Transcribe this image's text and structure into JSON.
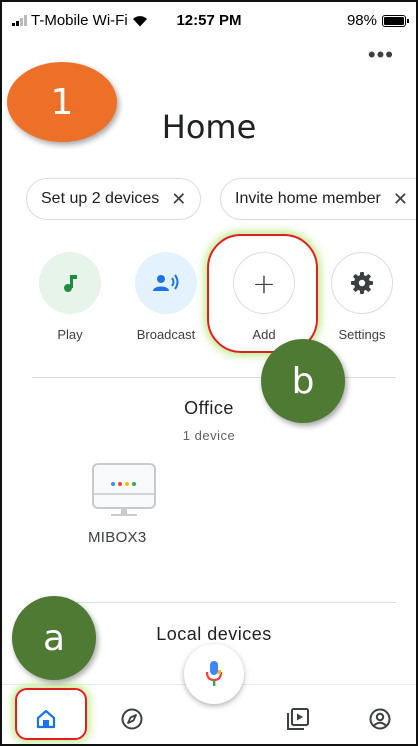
{
  "status_bar": {
    "carrier": "T-Mobile Wi-Fi",
    "time": "12:57 PM",
    "battery": "98%",
    "battery_level": 0.98
  },
  "header": {
    "menu_icon": "more-horizontal-icon",
    "title": "Home"
  },
  "chips": [
    {
      "label": "Set up 2 devices",
      "close": "✕"
    },
    {
      "label": "Invite home member",
      "close": "✕"
    }
  ],
  "actions": [
    {
      "label": "Play",
      "icon": "music-note-icon",
      "color": "#1e8e3e"
    },
    {
      "label": "Broadcast",
      "icon": "broadcast-icon",
      "color": "#1a73e8"
    },
    {
      "label": "Add",
      "icon": "plus-icon",
      "symbol": "+"
    },
    {
      "label": "Settings",
      "icon": "gear-icon"
    }
  ],
  "room": {
    "name": "Office",
    "count": "1 device",
    "devices": [
      {
        "name": "MIBOX3",
        "icon": "tv-box-icon"
      }
    ]
  },
  "local_section": {
    "title": "Local devices"
  },
  "mic": {
    "icon": "microphone-icon"
  },
  "bottom_nav": [
    {
      "id": "home",
      "icon": "home-icon",
      "selected": true
    },
    {
      "id": "discover",
      "icon": "compass-icon"
    },
    {
      "id": "media",
      "icon": "media-playlist-icon"
    },
    {
      "id": "account",
      "icon": "account-circle-icon"
    }
  ],
  "annotations": {
    "badge_1": "1",
    "badge_a": "a",
    "badge_b": "b",
    "badge_orange": "#ee7028",
    "badge_green": "#4e7a33",
    "highlight_color": "#e0201e"
  }
}
